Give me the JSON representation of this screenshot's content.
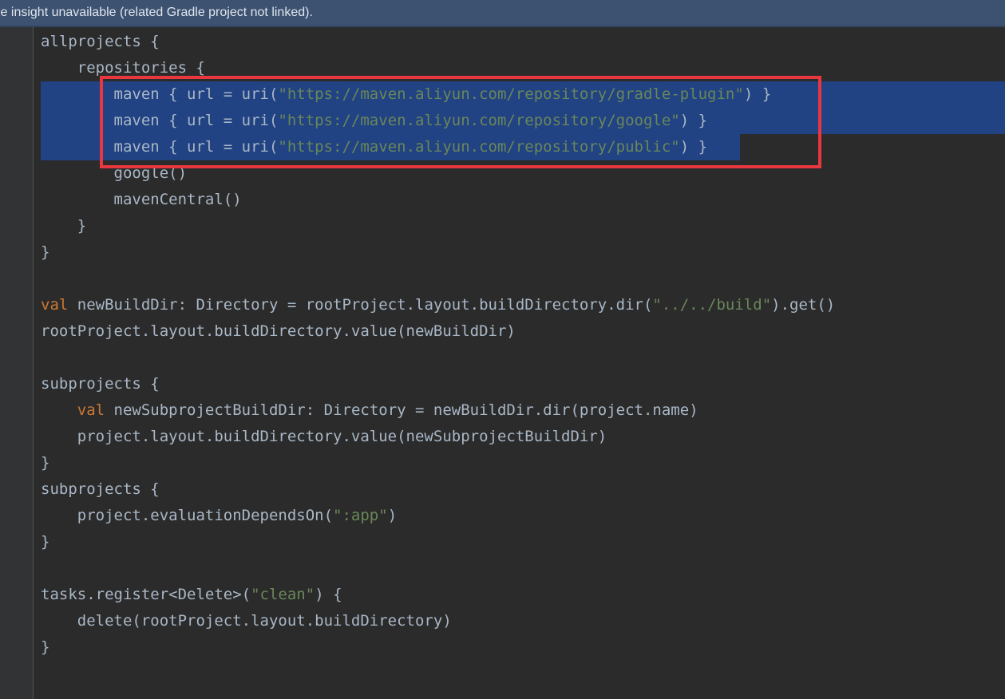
{
  "notification": {
    "text": "le insight unavailable (related Gradle project not linked)."
  },
  "code": {
    "lines": [
      [
        {
          "t": "allprojects {",
          "c": "p"
        }
      ],
      [
        {
          "t": "    repositories {",
          "c": "p"
        }
      ],
      [
        {
          "t": "        maven { url = uri(",
          "c": "p"
        },
        {
          "t": "\"https://maven.aliyun.com/repository/gradle-plugin\"",
          "c": "s"
        },
        {
          "t": ") }",
          "c": "p"
        }
      ],
      [
        {
          "t": "        maven { url = uri(",
          "c": "p"
        },
        {
          "t": "\"https://maven.aliyun.com/repository/google\"",
          "c": "s"
        },
        {
          "t": ") }",
          "c": "p"
        }
      ],
      [
        {
          "t": "        maven { url = uri(",
          "c": "p"
        },
        {
          "t": "\"https://maven.aliyun.com/repository/public\"",
          "c": "s"
        },
        {
          "t": ") }",
          "c": "p"
        }
      ],
      [
        {
          "t": "        google()",
          "c": "p"
        }
      ],
      [
        {
          "t": "        mavenCentral()",
          "c": "p"
        }
      ],
      [
        {
          "t": "    }",
          "c": "p"
        }
      ],
      [
        {
          "t": "}",
          "c": "p"
        }
      ],
      [],
      [
        {
          "t": "val",
          "c": "k"
        },
        {
          "t": " newBuildDir: Directory = rootProject.layout.buildDirectory.dir(",
          "c": "p"
        },
        {
          "t": "\"../../build\"",
          "c": "s"
        },
        {
          "t": ").get()",
          "c": "p"
        }
      ],
      [
        {
          "t": "rootProject.layout.buildDirectory.value(newBuildDir)",
          "c": "p"
        }
      ],
      [],
      [
        {
          "t": "subprojects {",
          "c": "p"
        }
      ],
      [
        {
          "t": "    ",
          "c": "p"
        },
        {
          "t": "val",
          "c": "k"
        },
        {
          "t": " newSubprojectBuildDir: Directory = newBuildDir.dir(project.name)",
          "c": "p"
        }
      ],
      [
        {
          "t": "    project.layout.buildDirectory.value(newSubprojectBuildDir)",
          "c": "p"
        }
      ],
      [
        {
          "t": "}",
          "c": "p"
        }
      ],
      [
        {
          "t": "subprojects {",
          "c": "p"
        }
      ],
      [
        {
          "t": "    project.evaluationDependsOn(",
          "c": "p"
        },
        {
          "t": "\":app\"",
          "c": "s"
        },
        {
          "t": ")",
          "c": "p"
        }
      ],
      [
        {
          "t": "}",
          "c": "p"
        }
      ],
      [],
      [
        {
          "t": "tasks.register<Delete>(",
          "c": "p"
        },
        {
          "t": "\"clean\"",
          "c": "s"
        },
        {
          "t": ") {",
          "c": "p"
        }
      ],
      [
        {
          "t": "    delete(rootProject.layout.buildDirectory)",
          "c": "p"
        }
      ],
      [
        {
          "t": "}",
          "c": "p"
        }
      ]
    ]
  },
  "selection": {
    "full_lines": [
      2,
      3
    ],
    "partial_line": 4
  },
  "colors": {
    "background": "#2b2b2b",
    "plain": "#a9b7c6",
    "keyword": "#cc7832",
    "string": "#6a8759",
    "selection": "#214283",
    "highlight_box": "#e8373f",
    "banner": "#3d5270"
  }
}
